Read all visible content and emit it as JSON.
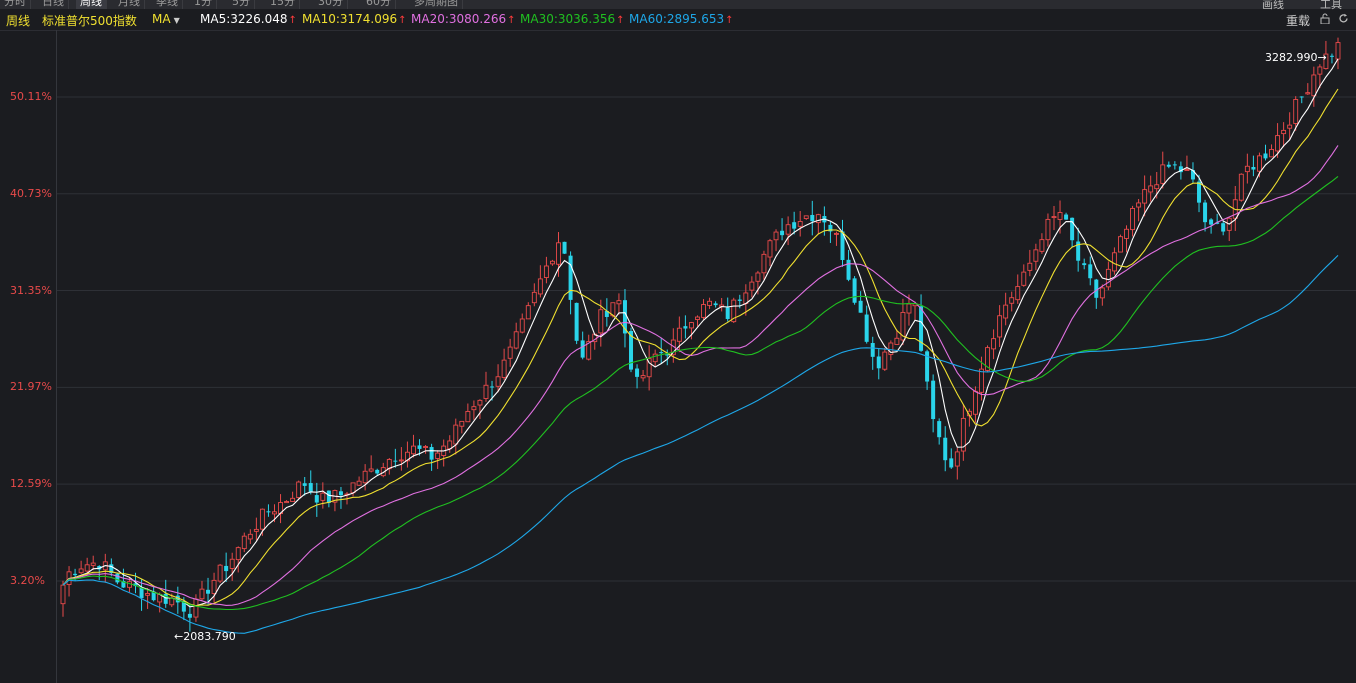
{
  "tabs": [
    "分时",
    "日线",
    "周线",
    "月线",
    "季线",
    "1分",
    "5分",
    "15分",
    "30分",
    "60分",
    "多周期图"
  ],
  "tabs_active": 2,
  "top_right": {
    "label_a": "画线",
    "label_b": "工具"
  },
  "toolbar": {
    "period": "周线",
    "index_name": "标准普尔500指数",
    "indicator": "MA",
    "ma5": "MA5:3226.048",
    "ma10": "MA10:3174.096",
    "ma20": "MA20:3080.266",
    "ma30": "MA30:3036.356",
    "ma60": "MA60:2895.653",
    "reload": "重载",
    "up_arrow": "↑"
  },
  "colors": {
    "ma5": "#ffffff",
    "ma10": "#f0e030",
    "ma20": "#e070e0",
    "ma30": "#20c020",
    "ma60": "#1ea7e8",
    "up_candle": "#e84a4a",
    "down_candle": "#2ad4ea",
    "percent_label": "#e84a4a"
  },
  "y_axis_labels": [
    "50.11%",
    "40.73%",
    "31.35%",
    "21.97%",
    "12.59%",
    "3.20%"
  ],
  "annotations": {
    "high": "3282.990→",
    "low": "←2083.790"
  },
  "chart_data": {
    "type": "candlestick",
    "title": "标准普尔500指数",
    "period": "weekly",
    "ylim_percent": [
      -5,
      55
    ],
    "y_ticks_percent": [
      3.2,
      12.59,
      21.97,
      31.35,
      40.73,
      50.11
    ],
    "base_value": 2021,
    "high_value": 3282.99,
    "low_value": 2083.79,
    "close_path_percent": [
      3.6,
      4.8,
      5.0,
      3.1,
      2.4,
      1.7,
      1.4,
      0.2,
      3.0,
      5.0,
      7.8,
      9.8,
      11.0,
      12.8,
      11.0,
      11.5,
      13.0,
      14.2,
      15.5,
      16.0,
      15.2,
      17.0,
      20.0,
      22.0,
      24.5,
      28.5,
      33.0,
      37.0,
      24.0,
      28.5,
      31.0,
      22.0,
      25.0,
      26.0,
      29.0,
      30.0,
      29.0,
      32.0,
      35.0,
      37.5,
      38.5,
      39.0,
      36.0,
      30.0,
      24.0,
      27.0,
      31.0,
      19.0,
      14.0,
      20.0,
      26.0,
      30.0,
      32.5,
      37.0,
      39.0,
      34.0,
      30.5,
      35.0,
      39.0,
      42.0,
      43.5,
      42.5,
      37.0,
      38.0,
      43.0,
      44.5,
      47.0,
      50.0,
      53.5,
      55.0
    ],
    "series": [
      {
        "name": "MA5",
        "value": 3226.048
      },
      {
        "name": "MA10",
        "value": 3174.096
      },
      {
        "name": "MA20",
        "value": 3080.266
      },
      {
        "name": "MA30",
        "value": 3036.356
      },
      {
        "name": "MA60",
        "value": 2895.653
      }
    ]
  }
}
